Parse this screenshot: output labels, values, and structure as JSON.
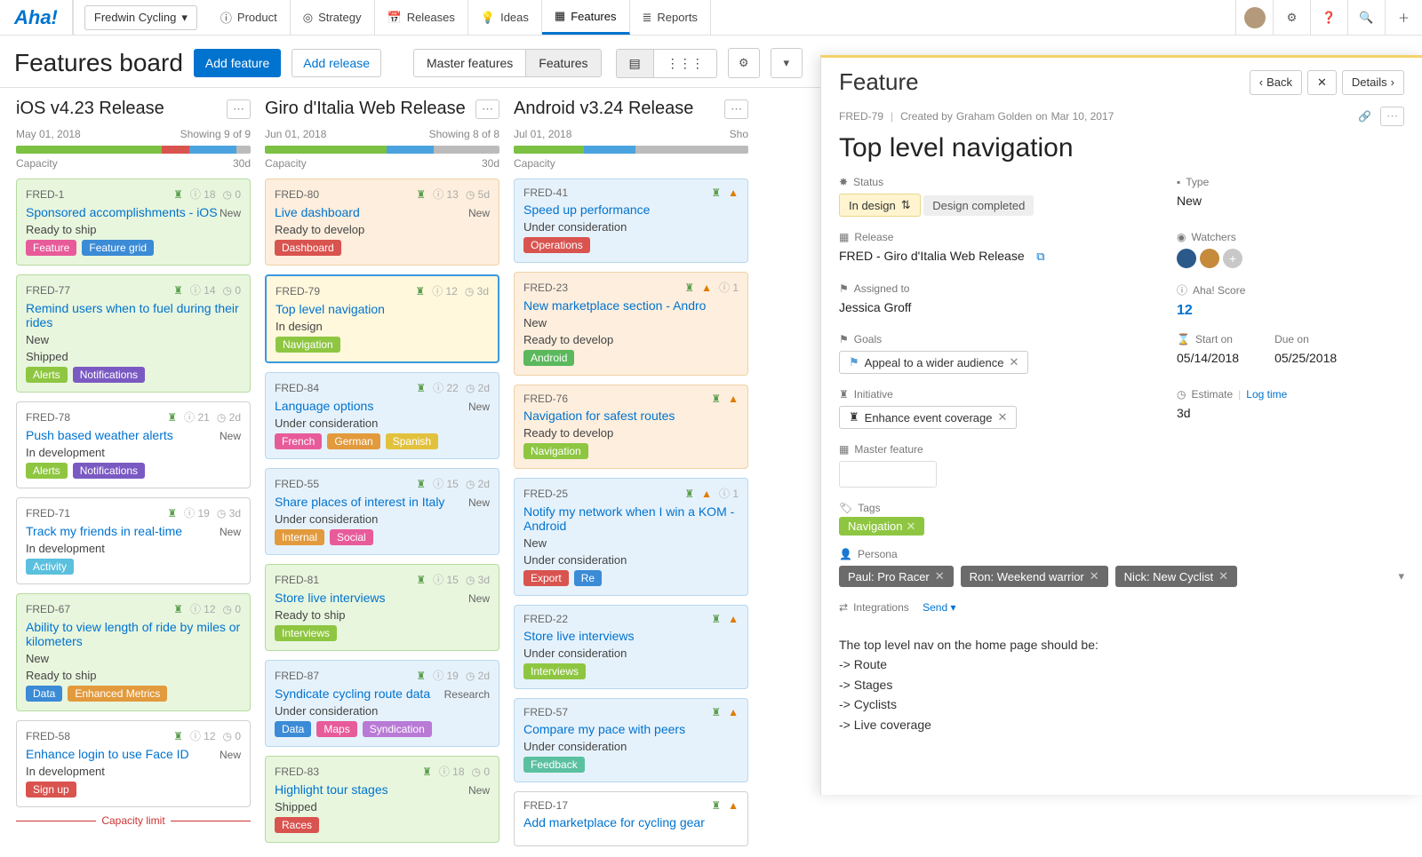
{
  "brand": "Aha!",
  "workspace": "Fredwin Cycling",
  "nav": {
    "product": "Product",
    "strategy": "Strategy",
    "releases": "Releases",
    "ideas": "Ideas",
    "features": "Features",
    "reports": "Reports"
  },
  "page": {
    "title": "Features board",
    "add_feature": "Add feature",
    "add_release": "Add release",
    "seg_master": "Master features",
    "seg_features": "Features"
  },
  "columns": [
    {
      "title": "iOS v4.23 Release",
      "date": "May 01, 2018",
      "showing": "Showing 9 of 9",
      "capacity_label": "Capacity",
      "capacity_value": "30d",
      "progress": [
        [
          "#7cc142",
          62
        ],
        [
          "#d9534f",
          12
        ],
        [
          "#4aa3df",
          20
        ],
        [
          "#bbb",
          6
        ]
      ],
      "capacity_limit": "Capacity limit",
      "cards": [
        {
          "id": "FRED-1",
          "title": "Sponsored accomplishments - iOS",
          "status": "Ready to ship",
          "cls": "green",
          "info": "18",
          "clock": "0",
          "new": true,
          "tags": [
            [
              "Feature",
              "#e85b9a"
            ],
            [
              "Feature grid",
              "#3b8bd6"
            ]
          ]
        },
        {
          "id": "FRED-77",
          "title": "Remind users when to fuel during their rides",
          "status": "New",
          "status2": "Shipped",
          "cls": "green",
          "info": "14",
          "clock": "0",
          "tags": [
            [
              "Alerts",
              "#8ec641"
            ],
            [
              "Notifications",
              "#7a5ac2"
            ]
          ]
        },
        {
          "id": "FRED-78",
          "title": "Push based weather alerts",
          "status": "In development",
          "cls": "",
          "info": "21",
          "clock": "2d",
          "new": true,
          "tags": [
            [
              "Alerts",
              "#8ec641"
            ],
            [
              "Notifications",
              "#7a5ac2"
            ]
          ]
        },
        {
          "id": "FRED-71",
          "title": "Track my friends in real-time",
          "status": "In development",
          "cls": "",
          "info": "19",
          "clock": "3d",
          "new": true,
          "tags": [
            [
              "Activity",
              "#5bc0de"
            ]
          ]
        },
        {
          "id": "FRED-67",
          "title": "Ability to view length of ride by miles or kilometers",
          "status": "New",
          "status2": "Ready to ship",
          "cls": "green",
          "info": "12",
          "clock": "0",
          "tags": [
            [
              "Data",
              "#3b8bd6"
            ],
            [
              "Enhanced Metrics",
              "#e29a3d"
            ]
          ]
        },
        {
          "id": "FRED-58",
          "title": "Enhance login to use Face ID",
          "status": "In development",
          "cls": "",
          "info": "12",
          "clock": "0",
          "new": true,
          "tags": [
            [
              "Sign up",
              "#d9534f"
            ]
          ]
        }
      ]
    },
    {
      "title": "Giro d'Italia Web Release",
      "date": "Jun 01, 2018",
      "showing": "Showing 8 of 8",
      "capacity_label": "Capacity",
      "capacity_value": "30d",
      "progress": [
        [
          "#7cc142",
          52
        ],
        [
          "#4aa3df",
          20
        ],
        [
          "#bbb",
          28
        ]
      ],
      "cards": [
        {
          "id": "FRED-80",
          "title": "Live dashboard",
          "status": "Ready to develop",
          "cls": "orange",
          "info": "13",
          "clock": "5d",
          "new": true,
          "tags": [
            [
              "Dashboard",
              "#d9534f"
            ]
          ]
        },
        {
          "id": "FRED-79",
          "title": "Top level navigation",
          "status": "In design",
          "cls": "yellow selected",
          "info": "12",
          "clock": "3d",
          "tags": [
            [
              "Navigation",
              "#8ec641"
            ]
          ]
        },
        {
          "id": "FRED-84",
          "title": "Language options",
          "status": "Under consideration",
          "cls": "blue",
          "info": "22",
          "clock": "2d",
          "new": true,
          "tags": [
            [
              "French",
              "#e85b9a"
            ],
            [
              "German",
              "#e29a3d"
            ],
            [
              "Spanish",
              "#e2c13d"
            ]
          ]
        },
        {
          "id": "FRED-55",
          "title": "Share places of interest in Italy",
          "status": "Under consideration",
          "cls": "blue",
          "info": "15",
          "clock": "2d",
          "new": true,
          "tags": [
            [
              "Internal",
              "#e29a3d"
            ],
            [
              "Social",
              "#e85b9a"
            ]
          ]
        },
        {
          "id": "FRED-81",
          "title": "Store live interviews",
          "status": "Ready to ship",
          "cls": "green",
          "info": "15",
          "clock": "3d",
          "new": true,
          "tags": [
            [
              "Interviews",
              "#8ec641"
            ]
          ]
        },
        {
          "id": "FRED-87",
          "title": "Syndicate cycling route data",
          "status": "Under consideration",
          "cls": "blue",
          "info": "19",
          "clock": "2d",
          "research": true,
          "tags": [
            [
              "Data",
              "#3b8bd6"
            ],
            [
              "Maps",
              "#e85b9a"
            ],
            [
              "Syndication",
              "#b97ad6"
            ]
          ]
        },
        {
          "id": "FRED-83",
          "title": "Highlight tour stages",
          "status": "Shipped",
          "cls": "green",
          "info": "18",
          "clock": "0",
          "new": true,
          "tags": [
            [
              "Races",
              "#d9534f"
            ]
          ]
        }
      ]
    },
    {
      "title": "Android v3.24 Release",
      "date": "Jul 01, 2018",
      "showing": "Sho",
      "capacity_label": "Capacity",
      "capacity_value": "",
      "progress": [
        [
          "#7cc142",
          30
        ],
        [
          "#4aa3df",
          22
        ],
        [
          "#bbb",
          48
        ]
      ],
      "cards": [
        {
          "id": "FRED-41",
          "title": "Speed up performance",
          "status": "Under consideration",
          "cls": "blue",
          "warn": true,
          "info": "",
          "tags": [
            [
              "Operations",
              "#d9534f"
            ]
          ]
        },
        {
          "id": "FRED-23",
          "title": "New marketplace section - Andro",
          "status": "New",
          "status2": "Ready to develop",
          "cls": "orange",
          "warn": true,
          "info": "1",
          "tags": [
            [
              "Android",
              "#5cb85c"
            ]
          ]
        },
        {
          "id": "FRED-76",
          "title": "Navigation for safest routes",
          "status": "Ready to develop",
          "cls": "orange",
          "warn": true,
          "tags": [
            [
              "Navigation",
              "#8ec641"
            ]
          ]
        },
        {
          "id": "FRED-25",
          "title": "Notify my network when I win a KOM - Android",
          "status": "New",
          "status2": "Under consideration",
          "cls": "blue",
          "warn": true,
          "info": "1",
          "tags": [
            [
              "Export",
              "#d9534f"
            ],
            [
              "Re",
              "#3b8bd6"
            ]
          ]
        },
        {
          "id": "FRED-22",
          "title": "Store live interviews",
          "status": "Under consideration",
          "cls": "blue",
          "warn": true,
          "tags": [
            [
              "Interviews",
              "#8ec641"
            ]
          ]
        },
        {
          "id": "FRED-57",
          "title": "Compare my pace with peers",
          "status": "Under consideration",
          "cls": "blue",
          "warn": true,
          "tags": [
            [
              "Feedback",
              "#5bc0a0"
            ]
          ]
        },
        {
          "id": "FRED-17",
          "title": "Add marketplace for cycling gear",
          "status": "",
          "cls": "",
          "warn": true,
          "tags": []
        }
      ]
    }
  ],
  "detail": {
    "kind": "Feature",
    "back": "Back",
    "details": "Details",
    "id": "FRED-79",
    "created_prefix": "Created by",
    "created_by": "Graham Golden",
    "created_on_prefix": "on",
    "created_on": "Mar 10, 2017",
    "title": "Top level navigation",
    "labels": {
      "status": "Status",
      "release": "Release",
      "assigned": "Assigned to",
      "goals": "Goals",
      "initiative": "Initiative",
      "master": "Master feature",
      "tags": "Tags",
      "persona": "Persona",
      "type": "Type",
      "watchers": "Watchers",
      "score": "Aha! Score",
      "start": "Start on",
      "due": "Due on",
      "estimate": "Estimate",
      "logtime": "Log time",
      "integrations": "Integrations",
      "send": "Send"
    },
    "status_value": "In design",
    "status_action": "Design completed",
    "release_value": "FRED - Giro d'Italia Web Release",
    "assigned_value": "Jessica Groff",
    "goal_value": "Appeal to a wider audience",
    "initiative_value": "Enhance event coverage",
    "tag_value": "Navigation",
    "personas": [
      "Paul: Pro Racer",
      "Ron: Weekend warrior",
      "Nick: New Cyclist"
    ],
    "type_value": "New",
    "score_value": "12",
    "start_value": "05/14/2018",
    "due_value": "05/25/2018",
    "estimate_value": "3d",
    "description": [
      "The top level nav on the home page should be:",
      "-> Route",
      "-> Stages",
      "-> Cyclists",
      "-> Live coverage"
    ]
  }
}
